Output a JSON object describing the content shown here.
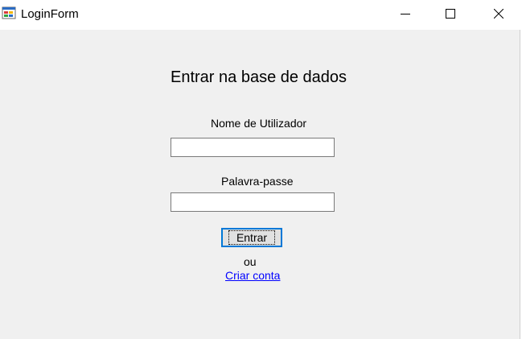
{
  "window": {
    "title": "LoginForm",
    "controls": {
      "minimize_icon": "minimize-icon",
      "maximize_icon": "maximize-icon",
      "close_icon": "close-icon"
    },
    "app_icon": "windows-form-icon"
  },
  "form": {
    "heading": "Entrar na base de dados",
    "username_label": "Nome de Utilizador",
    "username_value": "",
    "password_label": "Palavra-passe",
    "password_value": "",
    "submit_label": "Entrar",
    "separator_text": "ou",
    "create_account_link": "Criar conta"
  },
  "colors": {
    "window_background": "#f0f0f0",
    "titlebar_background": "#ffffff",
    "button_focus_border": "#0078d7",
    "link": "#0000ff"
  }
}
